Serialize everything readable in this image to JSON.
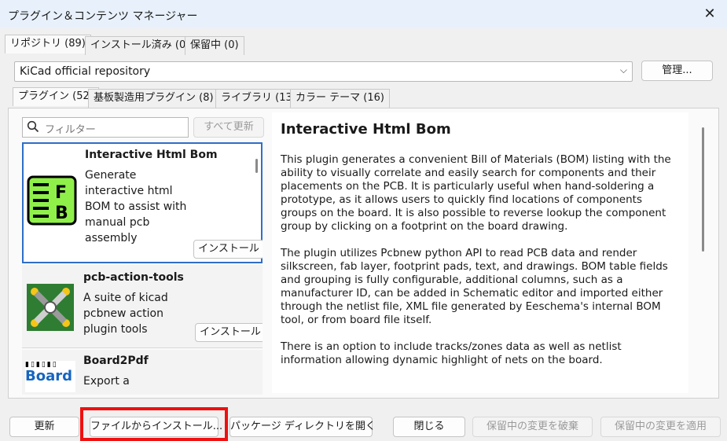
{
  "window": {
    "title": "プラグイン＆コンテンツ マネージャー",
    "close_icon": "close-icon"
  },
  "top_tabs": [
    {
      "label": "リポジトリ (89)",
      "active": true
    },
    {
      "label": "インストール済み (0)",
      "active": false
    },
    {
      "label": "保留中 (0)",
      "active": false
    }
  ],
  "repository": {
    "selected": "KiCad official repository",
    "manage_label": "管理..."
  },
  "sub_tabs": [
    {
      "label": "プラグイン (52)",
      "active": true
    },
    {
      "label": "基板製造用プラグイン (8)",
      "active": false
    },
    {
      "label": "ライブラリ (13)",
      "active": false
    },
    {
      "label": "カラー テーマ (16)",
      "active": false
    }
  ],
  "filter": {
    "placeholder": "フィルター",
    "update_all_label": "すべて更新"
  },
  "packages": [
    {
      "name": "Interactive Html Bom",
      "description": "Generate interactive html BOM to assist with manual pcb assembly",
      "install_label": "インストール",
      "selected": true
    },
    {
      "name": "pcb-action-tools",
      "description": "A suite of kicad pcbnew action plugin tools",
      "install_label": "インストール",
      "selected": false
    },
    {
      "name": "Board2Pdf",
      "description": "Export a",
      "logo_text": "Board",
      "selected": false
    }
  ],
  "detail": {
    "title": "Interactive Html Bom",
    "paragraphs": [
      "This plugin generates a convenient Bill of Materials (BOM) listing with the ability to visually correlate and easily search for components and their placements on the PCB. It is particularly useful when hand-soldering a prototype, as it allows users to quickly find locations of components groups on the board. It is also possible to reverse lookup the component group by clicking on a footprint on the board drawing.",
      "The plugin utilizes Pcbnew python API to read PCB data and render silkscreen, fab layer, footprint pads, text, and drawings. BOM table fields and grouping is fully configurable, additional columns, such as a manufacturer ID, can be added in Schematic editor and imported either through the netlist file, XML file generated by Eeschema's internal BOM tool, or from board file itself.",
      "There is an option to include tracks/zones data as well as netlist information allowing dynamic highlight of nets on the board."
    ]
  },
  "footer": {
    "update": "更新",
    "install_from_file": "ファイルからインストール...",
    "open_package_dir": "パッケージ ディレクトリを開く",
    "close": "閉じる",
    "discard_pending": "保留中の変更を破棄",
    "apply_pending": "保留中の変更を適用"
  },
  "colors": {
    "accent": "#2f6ec7",
    "highlight": "#ef1010",
    "titlebar": "#e8f1fb"
  }
}
